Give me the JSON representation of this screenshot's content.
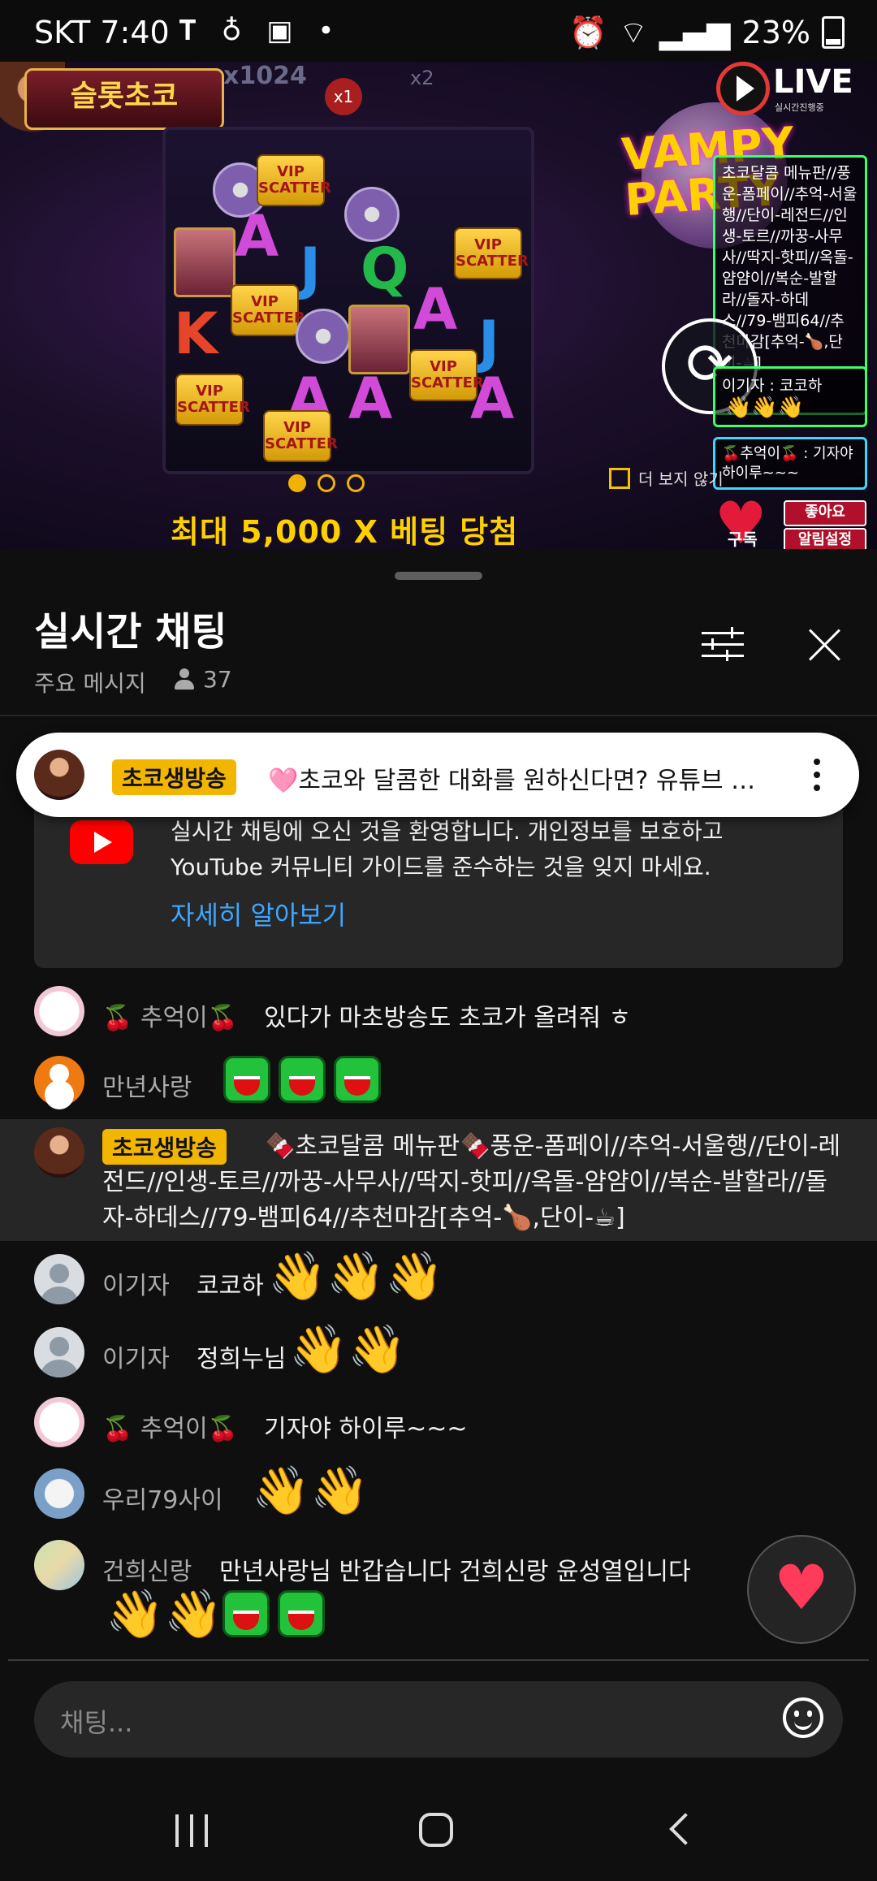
{
  "status_bar": {
    "carrier_time": "SKT 7:40",
    "battery": "23%",
    "icons": [
      "tmap-icon",
      "person-icon",
      "folder-icon",
      "dot-icon",
      "alarm-icon",
      "wifi-icon",
      "signal-icon",
      "battery-icon"
    ]
  },
  "video": {
    "game_logo": "슬롯초코",
    "multiplier_top": "x1024",
    "multiplier_badge": "x1",
    "multiplier_side": "x2",
    "live_label": "LIVE",
    "live_sub": "실시간진행중",
    "game_title_line1": "VAMPY",
    "game_title_line2": "PARTY",
    "menu_text": "초코달콤 메뉴판//풍운-폼페이//추억-서울행//단이-레전드//인생-토르//까꿍-사무사//딱지-핫피//옥돌-얌얌이//복순-발할라//돌자-하데스//79-뱀피64//추천마감[추억-🍗,단이-☕]",
    "mini_chat1": "이기자 : 코코하",
    "mini_chat2": "🍒추억이🍒 : 기자야 하이루~~~",
    "no_more_label": "더 보지 않기",
    "subscribe_label": "구독",
    "like_label": "좋아요",
    "notify_label": "알림설정",
    "max_win": "최대 5,000 X 베팅 당첨",
    "carousel_index": 1,
    "carousel_count": 3,
    "vip_label": "VIP SCATTER",
    "reel_letters": [
      "A",
      "J",
      "Q",
      "K",
      "A",
      "A",
      "A",
      "J",
      "A"
    ]
  },
  "chat": {
    "title": "실시간 채팅",
    "mode": "주요 메시지",
    "viewer_count": "37",
    "pinned": {
      "badge": "초코생방송",
      "text": "🩷초코와 달콤한 대화를 원하신다면? 유튜브 슬..."
    },
    "welcome": {
      "text": "실시간 채팅에 오신 것을 환영합니다. 개인정보를 보호하고 YouTube 커뮤니티 가이드를 준수하는 것을 잊지 마세요.",
      "link": "자세히 알아보기"
    },
    "messages": [
      {
        "name": "🍒 추억이🍒",
        "text": "있다가 마초방송도 초코가 올려줘 ㅎ"
      },
      {
        "name": "만년사랑",
        "text": ""
      },
      {
        "badge": "초코생방송",
        "text": "🍫초코달콤 메뉴판🍫풍운-폼페이//추억-서울행//단이-레전드//인생-토르//까꿍-사무사//딱지-핫피//옥돌-얌얌이//복순-발할라//돌자-하데스//79-뱀피64//추천마감[추억-🍗,단이-☕]"
      },
      {
        "name": "이기자",
        "text": "코코하"
      },
      {
        "name": "이기자",
        "text": "정희누님"
      },
      {
        "name": "🍒 추억이🍒",
        "text": "기자야 하이루~~~"
      },
      {
        "name": "우리79사이",
        "text": ""
      },
      {
        "name": "건희신랑",
        "text": "만년사랑님 반갑습니다 건희신랑 윤성열입니다"
      }
    ],
    "input_placeholder": "채팅..."
  },
  "colors": {
    "badge_yellow": "#f2b600",
    "link_blue": "#3ea6ff",
    "panel_bg": "#0f0f0f",
    "card_bg": "#272727",
    "wave_pink": "#ff2f80",
    "live_red": "#e53935"
  }
}
